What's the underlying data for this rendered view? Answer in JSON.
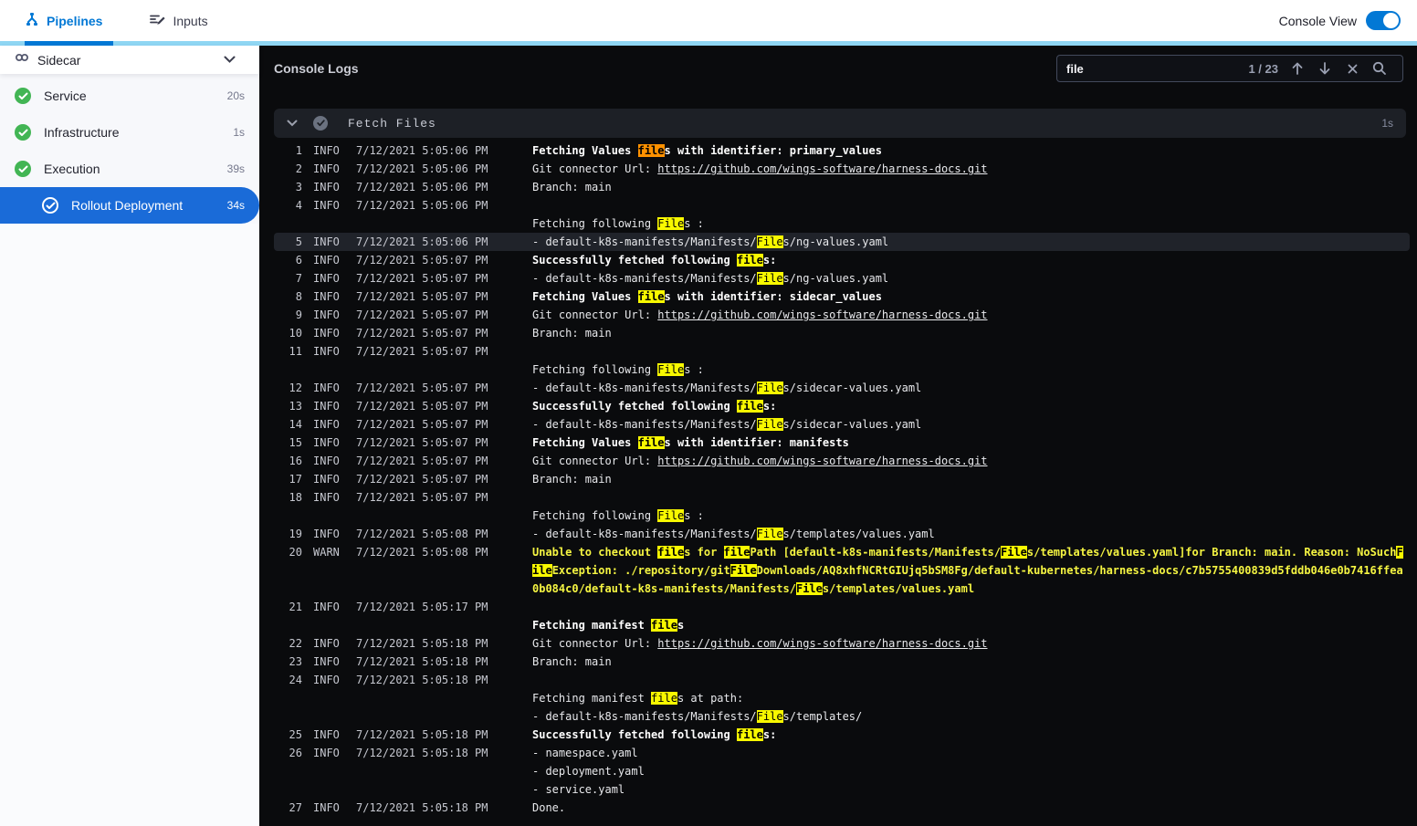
{
  "topbar": {
    "tabs": [
      {
        "label": "Pipelines"
      },
      {
        "label": "Inputs"
      }
    ],
    "console_view_label": "Console View",
    "console_view_on": true
  },
  "sidebar": {
    "stage": {
      "label": "Sidecar"
    },
    "items": [
      {
        "label": "Service",
        "duration": "20s",
        "status": "success"
      },
      {
        "label": "Infrastructure",
        "duration": "1s",
        "status": "success"
      },
      {
        "label": "Execution",
        "duration": "39s",
        "status": "success"
      },
      {
        "label": "Rollout Deployment",
        "duration": "34s",
        "status": "selected"
      }
    ]
  },
  "console": {
    "title": "Console Logs",
    "search": {
      "value": "file",
      "counter": "1 / 23"
    },
    "section": {
      "title": "Fetch Files",
      "duration": "1s"
    },
    "colors": {
      "accent_blue": "#0278d5",
      "selected_blue": "#1a6bd8",
      "success_green": "#42b554",
      "match_highlight": "#f8f800",
      "current_match_highlight": "#ff9100",
      "warn_text": "#f5f542"
    },
    "lines": [
      {
        "n": 1,
        "lvl": "INFO",
        "ts": "7/12/2021 5:05:06 PM",
        "bold": true,
        "rows": [
          [
            [
              "Fetching Values ",
              0
            ],
            [
              "file",
              2
            ],
            [
              "s with identifier: primary_values",
              0
            ]
          ]
        ]
      },
      {
        "n": 2,
        "lvl": "INFO",
        "ts": "7/12/2021 5:05:06 PM",
        "rows": [
          [
            [
              "Git connector Url: ",
              0
            ],
            [
              "https://github.com/wings-software/harness-docs.git",
              3
            ]
          ]
        ]
      },
      {
        "n": 3,
        "lvl": "INFO",
        "ts": "7/12/2021 5:05:06 PM",
        "rows": [
          [
            [
              "Branch: main",
              0
            ]
          ]
        ]
      },
      {
        "n": 4,
        "lvl": "INFO",
        "ts": "7/12/2021 5:05:06 PM",
        "rows": [
          [],
          [
            [
              "Fetching following ",
              0
            ],
            [
              "File",
              1
            ],
            [
              "s :",
              0
            ]
          ]
        ]
      },
      {
        "n": 5,
        "lvl": "INFO",
        "ts": "7/12/2021 5:05:06 PM",
        "sel": true,
        "rows": [
          [
            [
              "- default-k8s-manifests/Manifests/",
              0
            ],
            [
              "File",
              1
            ],
            [
              "s/ng-values.yaml",
              0
            ]
          ]
        ]
      },
      {
        "n": 6,
        "lvl": "INFO",
        "ts": "7/12/2021 5:05:07 PM",
        "bold": true,
        "rows": [
          [
            [
              "Successfully fetched following ",
              0
            ],
            [
              "file",
              1
            ],
            [
              "s:",
              0
            ]
          ]
        ]
      },
      {
        "n": 7,
        "lvl": "INFO",
        "ts": "7/12/2021 5:05:07 PM",
        "rows": [
          [
            [
              "- default-k8s-manifests/Manifests/",
              0
            ],
            [
              "File",
              1
            ],
            [
              "s/ng-values.yaml",
              0
            ]
          ]
        ]
      },
      {
        "n": 8,
        "lvl": "INFO",
        "ts": "7/12/2021 5:05:07 PM",
        "bold": true,
        "rows": [
          [
            [
              "Fetching Values ",
              0
            ],
            [
              "file",
              1
            ],
            [
              "s with identifier: sidecar_values",
              0
            ]
          ]
        ]
      },
      {
        "n": 9,
        "lvl": "INFO",
        "ts": "7/12/2021 5:05:07 PM",
        "rows": [
          [
            [
              "Git connector Url: ",
              0
            ],
            [
              "https://github.com/wings-software/harness-docs.git",
              3
            ]
          ]
        ]
      },
      {
        "n": 10,
        "lvl": "INFO",
        "ts": "7/12/2021 5:05:07 PM",
        "rows": [
          [
            [
              "Branch: main",
              0
            ]
          ]
        ]
      },
      {
        "n": 11,
        "lvl": "INFO",
        "ts": "7/12/2021 5:05:07 PM",
        "rows": [
          [],
          [
            [
              "Fetching following ",
              0
            ],
            [
              "File",
              1
            ],
            [
              "s :",
              0
            ]
          ]
        ]
      },
      {
        "n": 12,
        "lvl": "INFO",
        "ts": "7/12/2021 5:05:07 PM",
        "rows": [
          [
            [
              "- default-k8s-manifests/Manifests/",
              0
            ],
            [
              "File",
              1
            ],
            [
              "s/sidecar-values.yaml",
              0
            ]
          ]
        ]
      },
      {
        "n": 13,
        "lvl": "INFO",
        "ts": "7/12/2021 5:05:07 PM",
        "bold": true,
        "rows": [
          [
            [
              "Successfully fetched following ",
              0
            ],
            [
              "file",
              1
            ],
            [
              "s:",
              0
            ]
          ]
        ]
      },
      {
        "n": 14,
        "lvl": "INFO",
        "ts": "7/12/2021 5:05:07 PM",
        "rows": [
          [
            [
              "- default-k8s-manifests/Manifests/",
              0
            ],
            [
              "File",
              1
            ],
            [
              "s/sidecar-values.yaml",
              0
            ]
          ]
        ]
      },
      {
        "n": 15,
        "lvl": "INFO",
        "ts": "7/12/2021 5:05:07 PM",
        "bold": true,
        "rows": [
          [
            [
              "Fetching Values ",
              0
            ],
            [
              "file",
              1
            ],
            [
              "s with identifier: manifests",
              0
            ]
          ]
        ]
      },
      {
        "n": 16,
        "lvl": "INFO",
        "ts": "7/12/2021 5:05:07 PM",
        "rows": [
          [
            [
              "Git connector Url: ",
              0
            ],
            [
              "https://github.com/wings-software/harness-docs.git",
              3
            ]
          ]
        ]
      },
      {
        "n": 17,
        "lvl": "INFO",
        "ts": "7/12/2021 5:05:07 PM",
        "rows": [
          [
            [
              "Branch: main",
              0
            ]
          ]
        ]
      },
      {
        "n": 18,
        "lvl": "INFO",
        "ts": "7/12/2021 5:05:07 PM",
        "rows": [
          [],
          [
            [
              "Fetching following ",
              0
            ],
            [
              "File",
              1
            ],
            [
              "s :",
              0
            ]
          ]
        ]
      },
      {
        "n": 19,
        "lvl": "INFO",
        "ts": "7/12/2021 5:05:08 PM",
        "rows": [
          [
            [
              "- default-k8s-manifests/Manifests/",
              0
            ],
            [
              "File",
              1
            ],
            [
              "s/templates/values.yaml",
              0
            ]
          ]
        ]
      },
      {
        "n": 20,
        "lvl": "WARN",
        "ts": "7/12/2021 5:05:08 PM",
        "warn": true,
        "rows": [
          [
            [
              "Unable to checkout ",
              0
            ],
            [
              "file",
              1
            ],
            [
              "s for ",
              0
            ],
            [
              "file",
              1
            ],
            [
              "Path [default-k8s-manifests/Manifests/",
              0
            ],
            [
              "File",
              1
            ],
            [
              "s/templates/values.yaml]for Branch: main. Reason: NoSuch",
              0
            ],
            [
              "F",
              1
            ]
          ],
          [
            [
              "ile",
              1
            ],
            [
              "Exception: ./repository/git",
              0
            ],
            [
              "File",
              1
            ],
            [
              "Downloads/AQ8xhfNCRtGIUjq5bSM8Fg/default-kubernetes/harness-docs/c7b5755400839d5fddb046e0b7416ffea",
              0
            ]
          ],
          [
            [
              "0b084c0/default-k8s-manifests/Manifests/",
              0
            ],
            [
              "File",
              1
            ],
            [
              "s/templates/values.yaml",
              0
            ]
          ]
        ]
      },
      {
        "n": 21,
        "lvl": "INFO",
        "ts": "7/12/2021 5:05:17 PM",
        "bold": true,
        "rows": [
          [],
          [
            [
              "Fetching manifest ",
              0
            ],
            [
              "file",
              1
            ],
            [
              "s",
              0
            ]
          ]
        ]
      },
      {
        "n": 22,
        "lvl": "INFO",
        "ts": "7/12/2021 5:05:18 PM",
        "rows": [
          [
            [
              "Git connector Url: ",
              0
            ],
            [
              "https://github.com/wings-software/harness-docs.git",
              3
            ]
          ]
        ]
      },
      {
        "n": 23,
        "lvl": "INFO",
        "ts": "7/12/2021 5:05:18 PM",
        "rows": [
          [
            [
              "Branch: main",
              0
            ]
          ]
        ]
      },
      {
        "n": 24,
        "lvl": "INFO",
        "ts": "7/12/2021 5:05:18 PM",
        "rows": [
          [],
          [
            [
              "Fetching manifest ",
              0
            ],
            [
              "file",
              1
            ],
            [
              "s at path:",
              0
            ]
          ],
          [
            [
              "- default-k8s-manifests/Manifests/",
              0
            ],
            [
              "File",
              1
            ],
            [
              "s/templates/",
              0
            ]
          ]
        ]
      },
      {
        "n": 25,
        "lvl": "INFO",
        "ts": "7/12/2021 5:05:18 PM",
        "bold": true,
        "rows": [
          [
            [
              "Successfully fetched following ",
              0
            ],
            [
              "file",
              1
            ],
            [
              "s:",
              0
            ]
          ]
        ]
      },
      {
        "n": 26,
        "lvl": "INFO",
        "ts": "7/12/2021 5:05:18 PM",
        "rows": [
          [
            [
              "- namespace.yaml",
              0
            ]
          ],
          [
            [
              "- deployment.yaml",
              0
            ]
          ],
          [
            [
              "- service.yaml",
              0
            ]
          ]
        ]
      },
      {
        "n": 27,
        "lvl": "INFO",
        "ts": "7/12/2021 5:05:18 PM",
        "rows": [
          [
            [
              "Done.",
              0
            ]
          ]
        ]
      }
    ]
  }
}
